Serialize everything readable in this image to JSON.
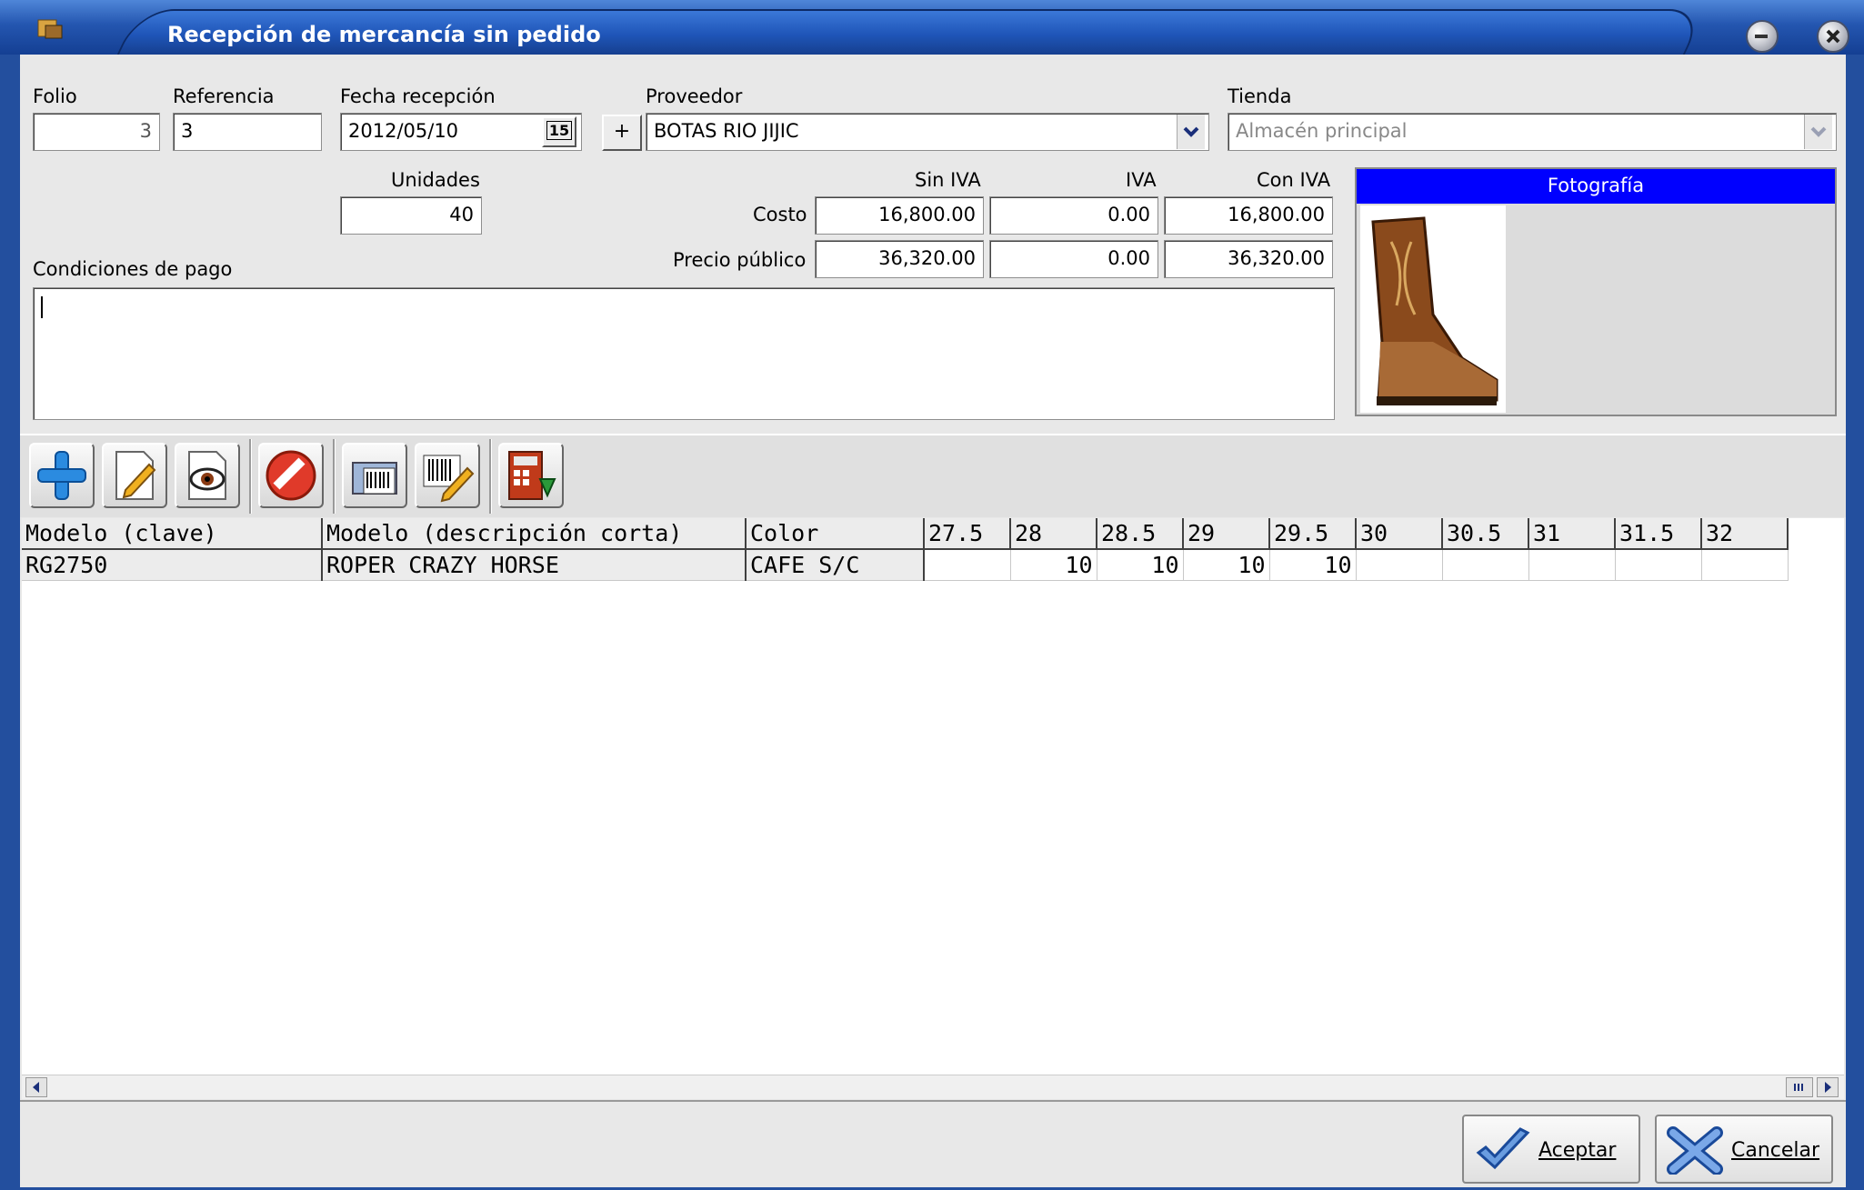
{
  "window": {
    "title": "Recepción de mercancía sin pedido"
  },
  "header": {
    "folio_label": "Folio",
    "folio_value": "3",
    "referencia_label": "Referencia",
    "referencia_value": "3",
    "fecha_label": "Fecha recepción",
    "fecha_value": "2012/05/10",
    "calendar_glyph": "15",
    "proveedor_label": "Proveedor",
    "proveedor_add": "+",
    "proveedor_value": "BOTAS RIO JIJIC",
    "tienda_label": "Tienda",
    "tienda_value": "Almacén principal"
  },
  "totals": {
    "unidades_label": "Unidades",
    "unidades_value": "40",
    "col_sin_iva": "Sin IVA",
    "col_iva": "IVA",
    "col_con_iva": "Con IVA",
    "costo_label": "Costo",
    "costo_sin": "16,800.00",
    "costo_iva": "0.00",
    "costo_con": "16,800.00",
    "precio_label": "Precio público",
    "precio_sin": "36,320.00",
    "precio_iva": "0.00",
    "precio_con": "36,320.00"
  },
  "condiciones": {
    "label": "Condiciones de pago",
    "value": ""
  },
  "photo": {
    "header": "Fotografía"
  },
  "toolbar": {
    "icons": [
      "add-icon",
      "edit-icon",
      "view-icon",
      "cancel-icon",
      "barcode-print-icon",
      "barcode-edit-icon",
      "calculator-icon"
    ]
  },
  "grid": {
    "headers": [
      "Modelo (clave)",
      "Modelo (descripción corta)",
      "Color",
      "27.5",
      "28",
      "28.5",
      "29",
      "29.5",
      "30",
      "30.5",
      "31",
      "31.5",
      "32"
    ],
    "rows": [
      [
        "RG2750",
        "ROPER CRAZY HORSE",
        "CAFE S/C",
        "",
        "10",
        "10",
        "10",
        "10",
        "",
        "",
        "",
        "",
        ""
      ]
    ]
  },
  "buttons": {
    "aceptar": "Aceptar",
    "cancelar": "Cancelar"
  },
  "colors": {
    "title_blue": "#1f55b8",
    "photo_header": "#0000ff",
    "panel_grey": "#e8e8e8"
  }
}
